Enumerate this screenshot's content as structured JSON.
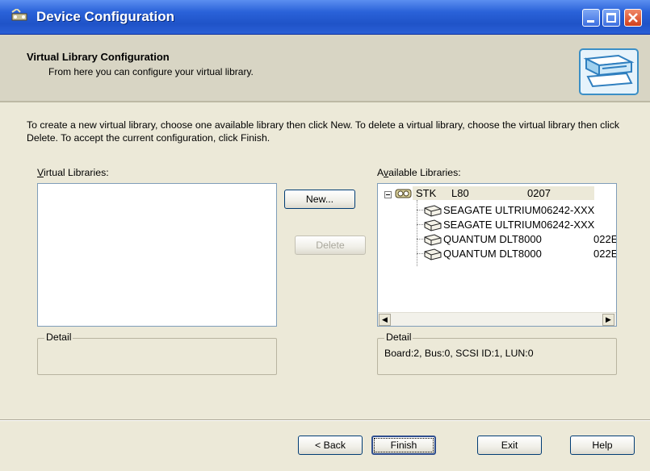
{
  "window": {
    "title": "Device Configuration"
  },
  "header": {
    "title": "Virtual Library Configuration",
    "subtitle": "From here you can configure your virtual library."
  },
  "instructions": "To create a new virtual library, choose one available library then click New. To delete a virtual library, choose the virtual library then click Delete. To accept the current configuration, click Finish.",
  "virtual_libraries": {
    "label_accel": "V",
    "label_rest": "irtual Libraries:",
    "items": []
  },
  "buttons": {
    "new": "New...",
    "delete": "Delete",
    "back": "< Back",
    "finish": "Finish",
    "exit": "Exit",
    "help": "Help"
  },
  "available_libraries": {
    "label_pre": "A",
    "label_accel": "v",
    "label_rest": "ailable Libraries:",
    "root": {
      "name": "STK",
      "model": "L80",
      "rev": "0207"
    },
    "children": [
      {
        "name": "SEAGATE ULTRIUM06242-XXX",
        "rev": ""
      },
      {
        "name": "SEAGATE ULTRIUM06242-XXX",
        "rev": ""
      },
      {
        "name": "QUANTUM DLT8000",
        "rev": "022E"
      },
      {
        "name": "QUANTUM DLT8000",
        "rev": "022E"
      }
    ]
  },
  "left_detail": {
    "label": "Detail",
    "text": ""
  },
  "right_detail": {
    "label": "Detail",
    "text": "Board:2, Bus:0, SCSI ID:1, LUN:0"
  },
  "colors": {
    "titlebar": "#2a62d9",
    "face": "#ece9d8",
    "header": "#d8d5c4"
  }
}
